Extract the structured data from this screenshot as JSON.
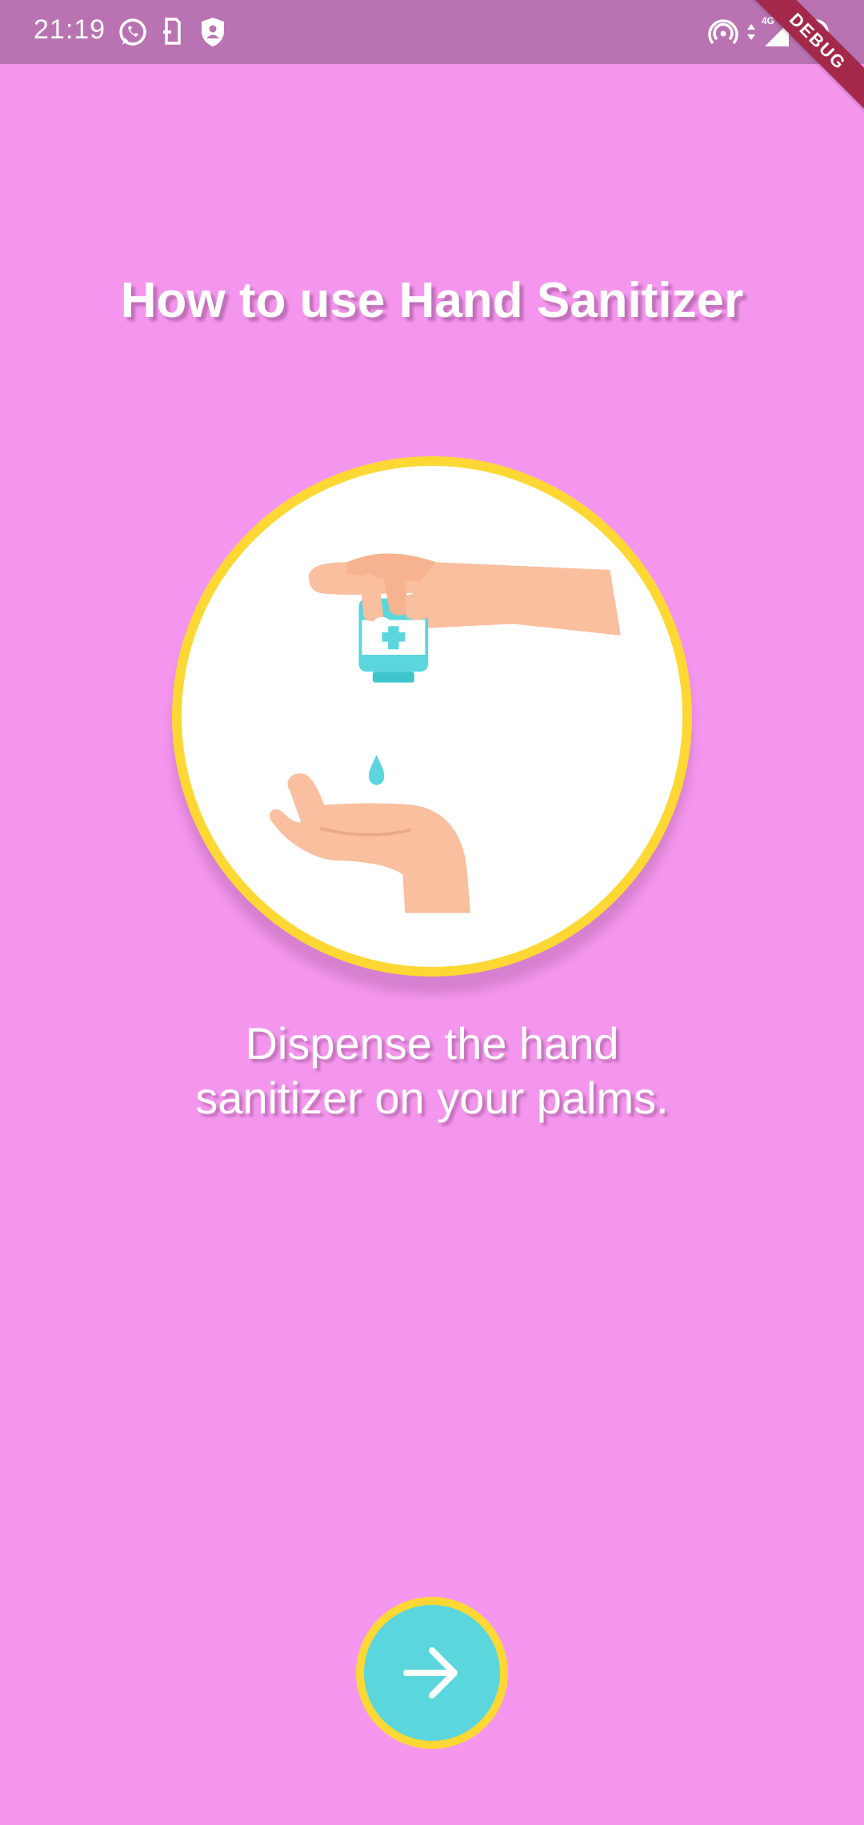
{
  "status_bar": {
    "time": "21:19",
    "network": "4G",
    "icons": [
      "whatsapp-icon",
      "sim-transfer-icon",
      "shield-person-icon",
      "hotspot-icon",
      "data-arrows-icon",
      "signal-icon",
      "face-icon"
    ]
  },
  "debug_banner": "DEBUG",
  "page": {
    "title": "How to use Hand Sanitizer",
    "instruction": "Dispense the hand sanitizer on your palms."
  },
  "illustration": {
    "icon": "hand-dispensing-sanitizer-illustration"
  },
  "next_button": {
    "icon": "arrow-right-icon"
  },
  "colors": {
    "background": "#f596ee",
    "status_bar": "#b973b2",
    "accent_yellow": "#fdd835",
    "button_cyan": "#5bd6dd",
    "skin": "#f9bf9f",
    "bottle": "#5bd6dd"
  }
}
